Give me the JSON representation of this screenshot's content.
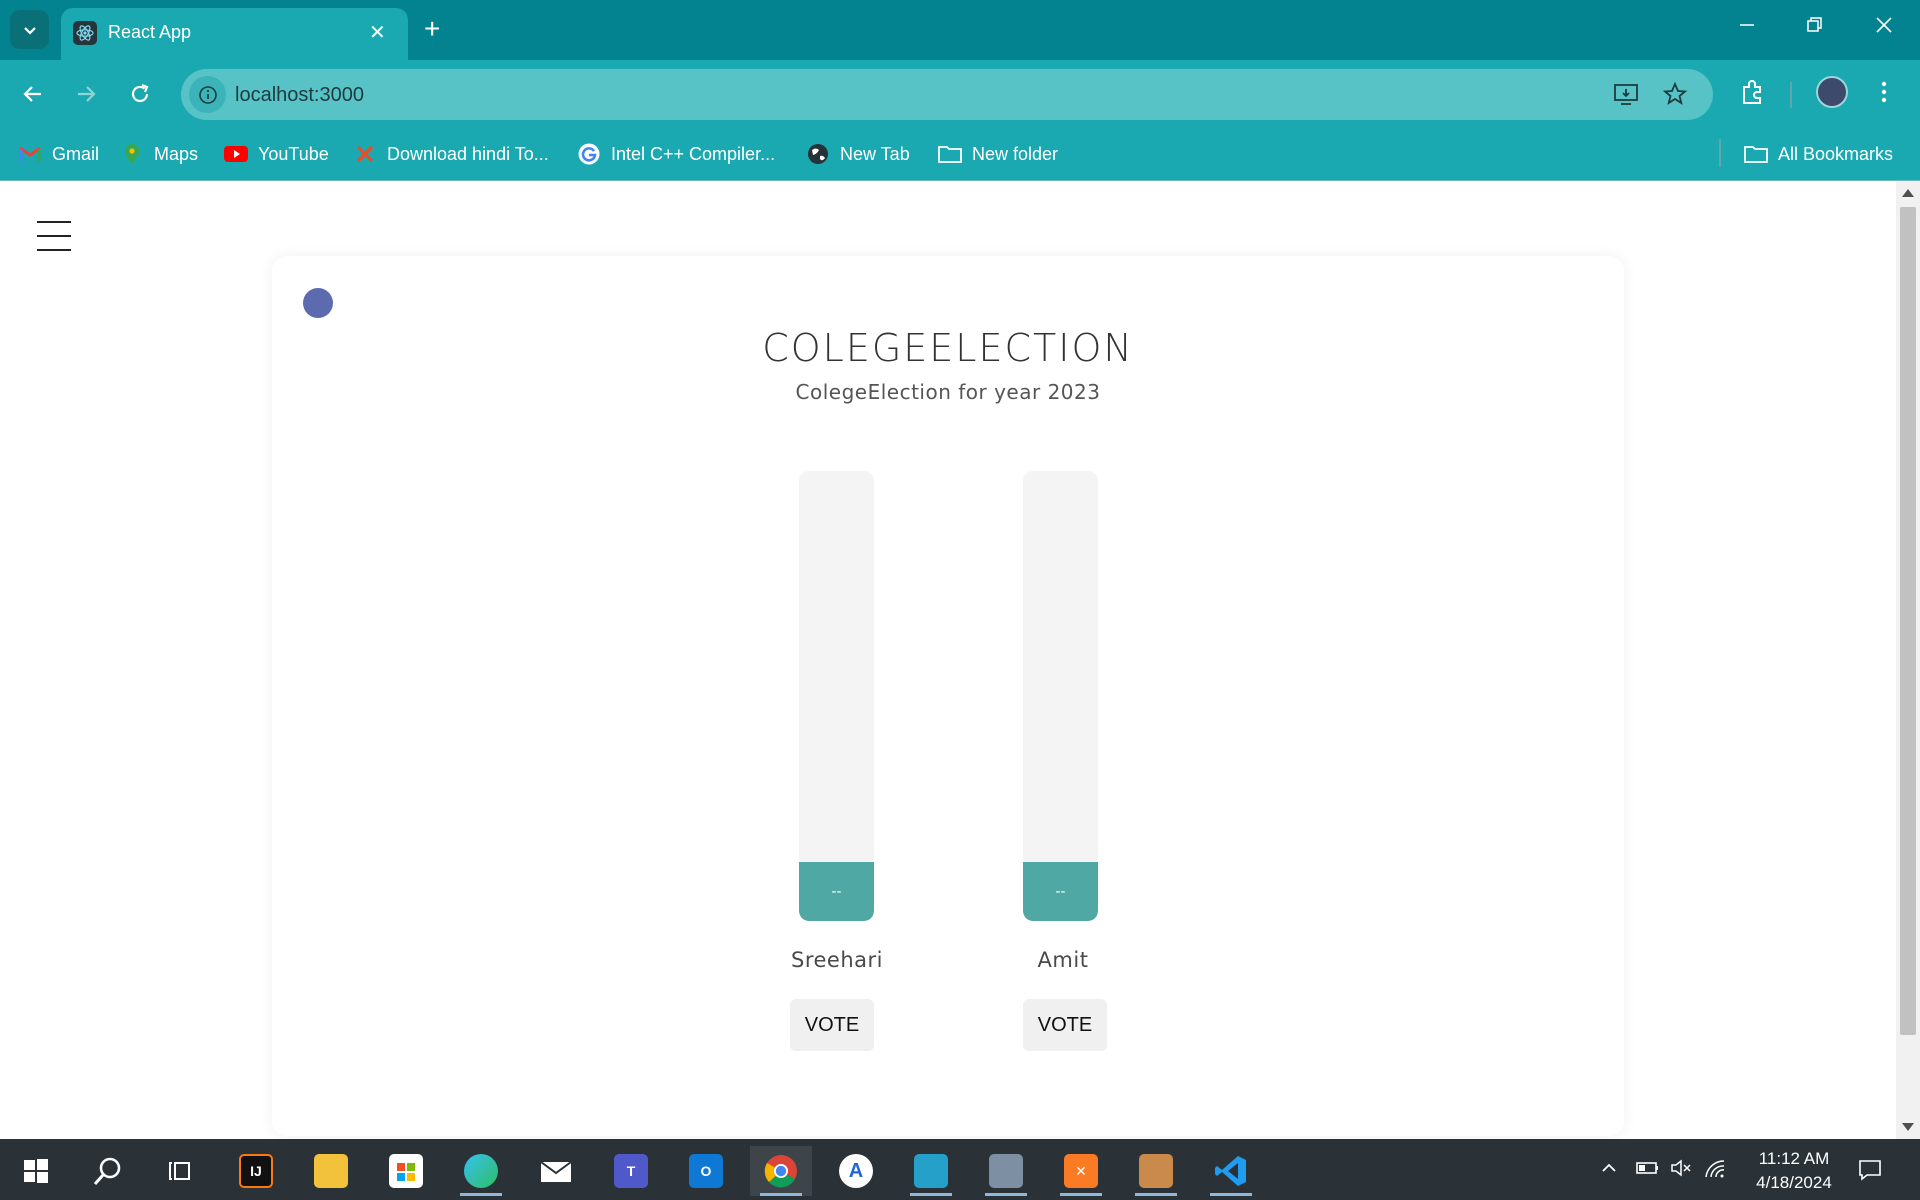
{
  "browser": {
    "tab_title": "React App",
    "url": "localhost:3000",
    "accent_color": "#1aa8b1",
    "bookmarks": [
      {
        "label": "Gmail",
        "icon": "gmail-icon"
      },
      {
        "label": "Maps",
        "icon": "maps-icon"
      },
      {
        "label": "YouTube",
        "icon": "youtube-icon"
      },
      {
        "label": "Download hindi To...",
        "icon": "download-site-icon"
      },
      {
        "label": "Intel C++ Compiler...",
        "icon": "google-icon"
      },
      {
        "label": "New Tab",
        "icon": "globe-icon"
      },
      {
        "label": "New folder",
        "icon": "folder-icon"
      }
    ],
    "all_bookmarks_label": "All Bookmarks"
  },
  "page": {
    "title": "COLEGEELECTION",
    "subtitle": "ColegeElection for year 2023",
    "status_dot_color": "#5c6bb0",
    "bar_color": "#4fa8a3",
    "candidates": [
      {
        "name": "Sreehari",
        "votes_display": "--",
        "vote_label": "VOTE"
      },
      {
        "name": "Amit",
        "votes_display": "--",
        "vote_label": "VOTE"
      }
    ]
  },
  "taskbar": {
    "time": "11:12 AM",
    "date": "4/18/2024",
    "apps": [
      "start-icon",
      "search-icon",
      "task-view-icon",
      "intellij-icon",
      "file-explorer-icon",
      "store-icon",
      "edge-icon",
      "mail-icon",
      "teams-icon",
      "outlook-icon",
      "chrome-icon",
      "app-icon",
      "app-icon",
      "app-icon",
      "xampp-icon",
      "app-icon",
      "vscode-icon"
    ]
  }
}
